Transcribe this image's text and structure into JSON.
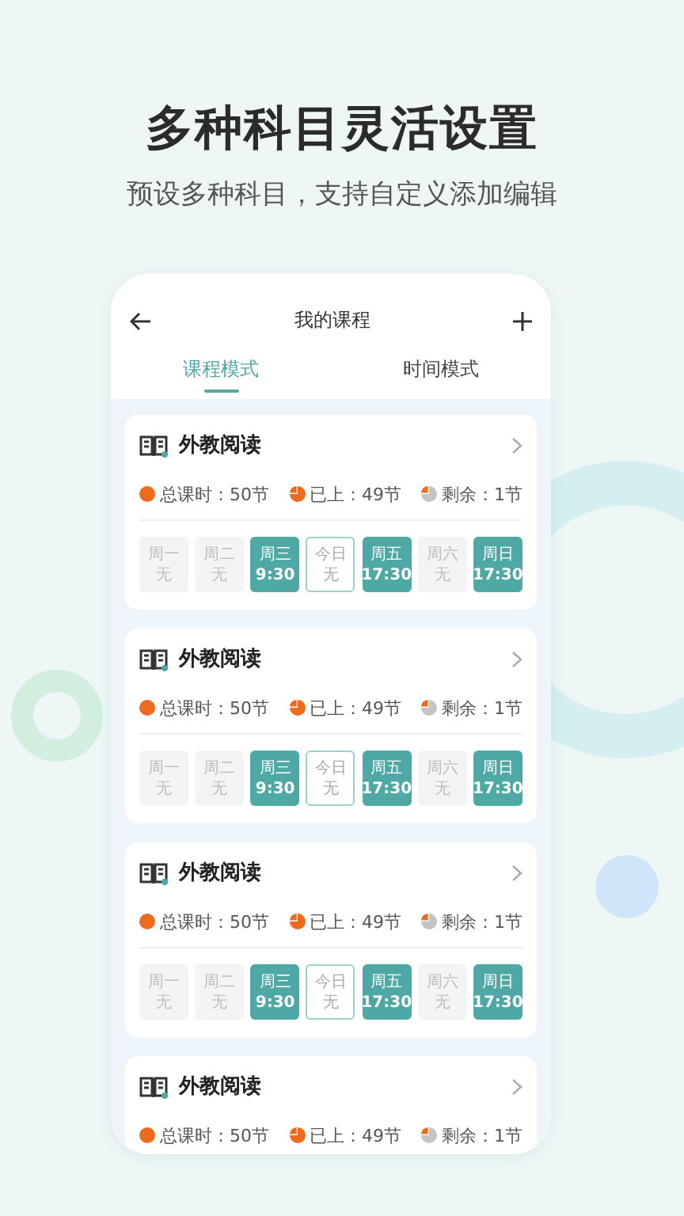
{
  "headline": "多种科目灵活设置",
  "subtitle": "预设多种科目，支持自定义添加编辑",
  "screen_title": "我的课程",
  "tabs": [
    {
      "label": "课程模式",
      "selected": true
    },
    {
      "label": "时间模式",
      "selected": false
    }
  ],
  "courses": [
    {
      "name": "外教阅读",
      "total": "总课时：50节",
      "done": "已上：49节",
      "remaining": "剩余：1节",
      "days": [
        {
          "kind": "none",
          "day": "周一",
          "time": "无"
        },
        {
          "kind": "none",
          "day": "周二",
          "time": "无"
        },
        {
          "kind": "scheduled",
          "day": "周三",
          "time": "9:30"
        },
        {
          "kind": "today",
          "day": "今日",
          "time": "无"
        },
        {
          "kind": "scheduled",
          "day": "周五",
          "time": "17:30"
        },
        {
          "kind": "none",
          "day": "周六",
          "time": "无"
        },
        {
          "kind": "scheduled",
          "day": "周日",
          "time": "17:30"
        }
      ]
    },
    {
      "name": "外教阅读",
      "total": "总课时：50节",
      "done": "已上：49节",
      "remaining": "剩余：1节",
      "days": [
        {
          "kind": "none",
          "day": "周一",
          "time": "无"
        },
        {
          "kind": "none",
          "day": "周二",
          "time": "无"
        },
        {
          "kind": "scheduled",
          "day": "周三",
          "time": "9:30"
        },
        {
          "kind": "today",
          "day": "今日",
          "time": "无"
        },
        {
          "kind": "scheduled",
          "day": "周五",
          "time": "17:30"
        },
        {
          "kind": "none",
          "day": "周六",
          "time": "无"
        },
        {
          "kind": "scheduled",
          "day": "周日",
          "time": "17:30"
        }
      ]
    },
    {
      "name": "外教阅读",
      "total": "总课时：50节",
      "done": "已上：49节",
      "remaining": "剩余：1节",
      "days": [
        {
          "kind": "none",
          "day": "周一",
          "time": "无"
        },
        {
          "kind": "none",
          "day": "周二",
          "time": "无"
        },
        {
          "kind": "scheduled",
          "day": "周三",
          "time": "9:30"
        },
        {
          "kind": "today",
          "day": "今日",
          "time": "无"
        },
        {
          "kind": "scheduled",
          "day": "周五",
          "time": "17:30"
        },
        {
          "kind": "none",
          "day": "周六",
          "time": "无"
        },
        {
          "kind": "scheduled",
          "day": "周日",
          "time": "17:30"
        }
      ]
    },
    {
      "name": "外教阅读",
      "total": "总课时：50节",
      "done": "已上：49节",
      "remaining": "剩余：1节"
    }
  ]
}
